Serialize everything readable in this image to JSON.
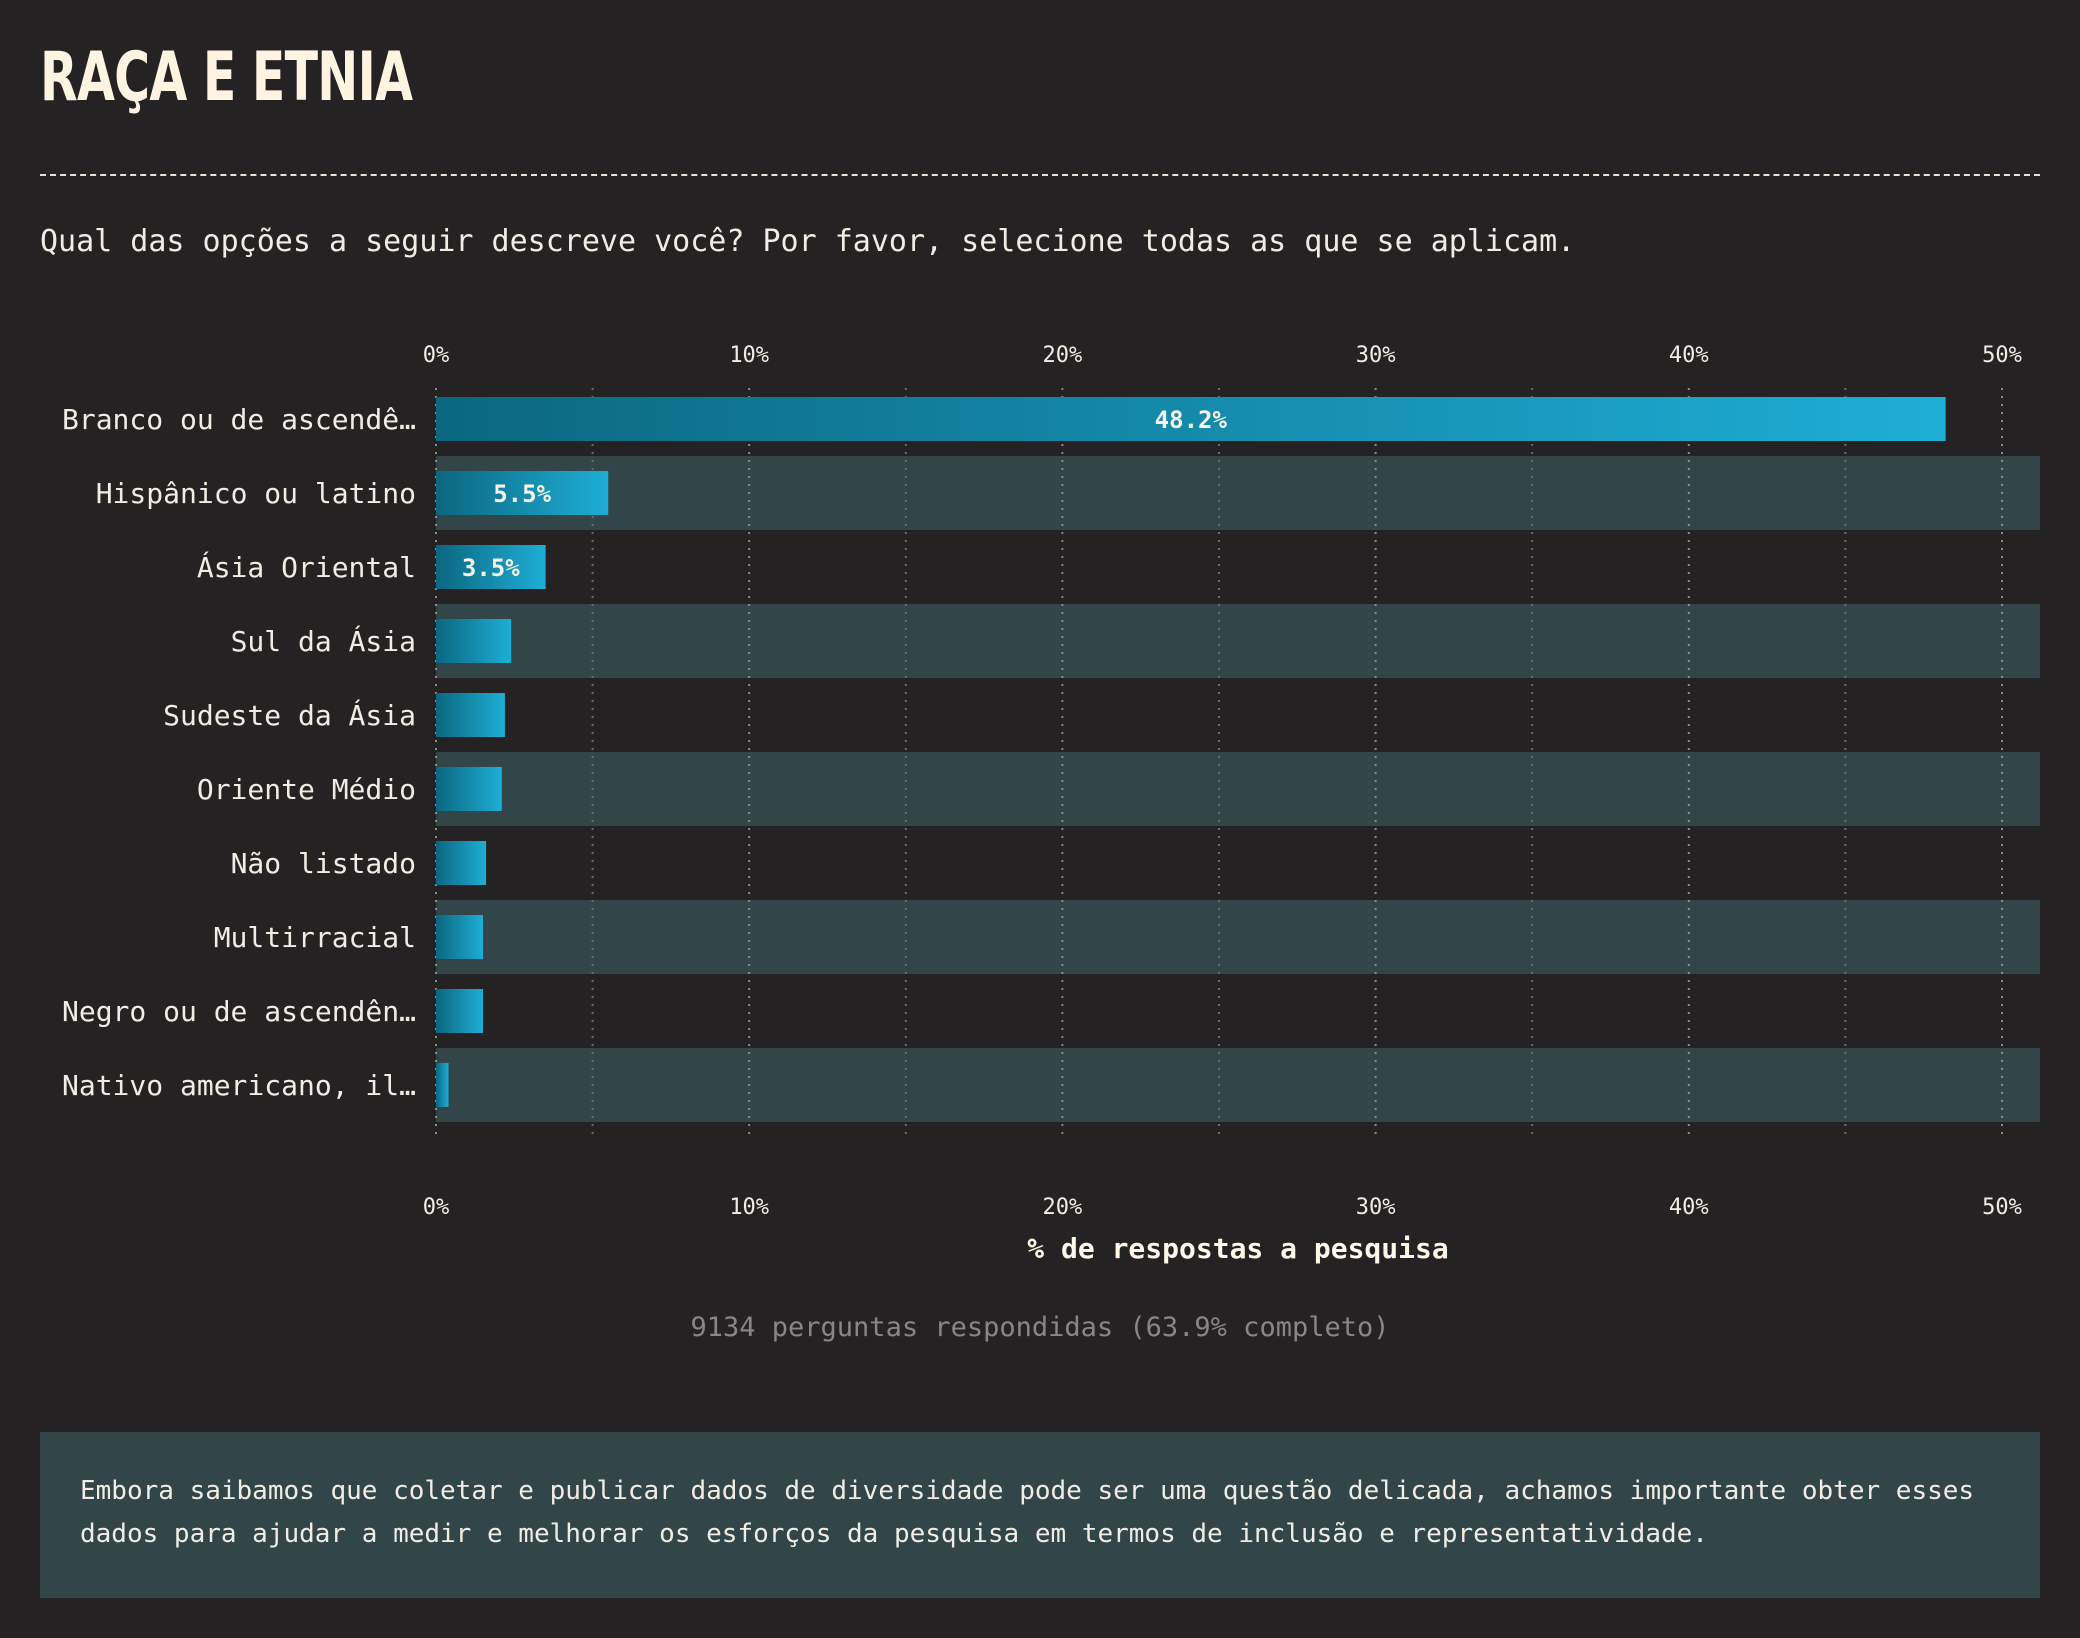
{
  "page": {
    "title": "RAÇA E ETNIA",
    "question": "Qual das opções a seguir descreve você? Por favor, selecione todas as que se aplicam.",
    "answered": "9134 perguntas respondidas (63.9% completo)",
    "note": "Embora saibamos que coletar e publicar dados de diversidade pode ser uma questão delicada, achamos importante obter esses dados para ajudar a medir e melhorar os esforços da pesquisa em termos de inclusão e representatividade."
  },
  "chart_data": {
    "type": "bar",
    "orientation": "horizontal",
    "categories": [
      "Branco ou de ascendê…",
      "Hispânico ou latino",
      "Ásia Oriental",
      "Sul da Ásia",
      "Sudeste da Ásia",
      "Oriente Médio",
      "Não listado",
      "Multirracial",
      "Negro ou de ascendên…",
      "Nativo americano, il…"
    ],
    "values": [
      48.2,
      5.5,
      3.5,
      2.4,
      2.2,
      2.1,
      1.6,
      1.5,
      1.5,
      0.4
    ],
    "data_labels": [
      "48.2%",
      "5.5%",
      "3.5%",
      "",
      "",
      "",
      "",
      "",
      "",
      ""
    ],
    "xlabel": "% de respostas a pesquisa",
    "xlim": [
      0,
      51.5
    ],
    "ticks": [
      0,
      10,
      20,
      30,
      40,
      50
    ],
    "tick_labels": [
      "0%",
      "10%",
      "20%",
      "30%",
      "40%",
      "50%"
    ],
    "grid": "vertical dotted",
    "colors": {
      "bar_start": "#0b6780",
      "bar_end": "#1eaed6",
      "row_band": "#324549",
      "background": "#252224"
    }
  }
}
